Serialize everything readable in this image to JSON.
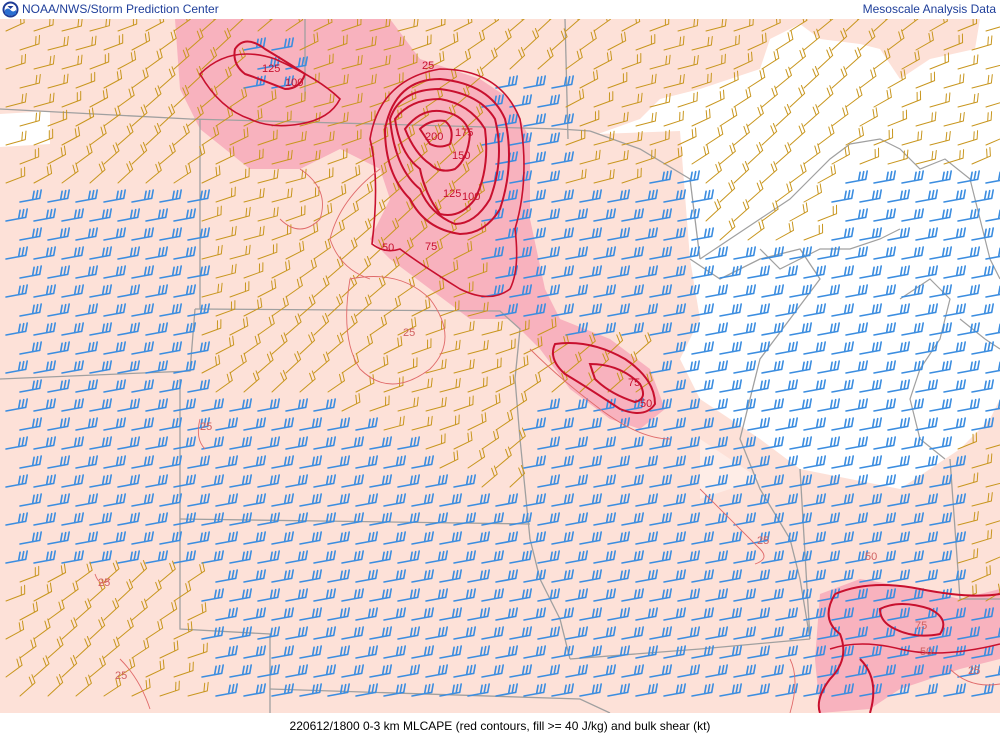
{
  "header": {
    "left_title": "NOAA/NWS/Storm Prediction Center",
    "right_title": "Mesoscale Analysis Data",
    "logo_icon": "noaa-logo-icon"
  },
  "footer": {
    "caption": "220612/1800 0-3 km MLCAPE (red contours, fill >= 40 J/kg) and bulk shear (kt)"
  },
  "map": {
    "contour_labels": [
      "125",
      "100",
      "25",
      "200",
      "175",
      "150",
      "125",
      "100",
      "50",
      "75",
      "25",
      "75",
      "50",
      "25",
      "25",
      "25",
      "25",
      "50",
      "75",
      "50",
      "25"
    ],
    "colors": {
      "background_fill": "#fde1d8",
      "cape_fill": "#f5a1b6",
      "contour": "#c8102e",
      "thin_contour": "#e06a6a",
      "barb_low": "#c8961e",
      "barb_high": "#3b8de0",
      "border": "#9c9c9c"
    }
  }
}
